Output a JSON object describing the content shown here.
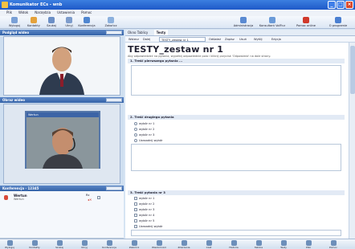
{
  "window": {
    "title": "Komunikator ECs - wnb"
  },
  "menu": [
    "Plik",
    "Widok",
    "Narzędzia",
    "Ustawienia",
    "Pomoc"
  ],
  "toolbar": {
    "left": [
      {
        "label": "Wyloguj",
        "icon": "logout-icon",
        "color": "#7aa0d6"
      },
      {
        "label": "Kontakty",
        "icon": "contacts-icon",
        "color": "#e4a23c"
      },
      {
        "label": "Szukaj",
        "icon": "search-icon",
        "color": "#6b8fc6"
      },
      {
        "label": "Ukryj",
        "icon": "hide-icon",
        "color": "#7d9ccc"
      },
      {
        "label": "Konferencja",
        "icon": "conference-icon",
        "color": "#4f86d0"
      },
      {
        "label": "Zakończ",
        "icon": "end-icon",
        "color": "#8cb0dd"
      }
    ],
    "right": [
      {
        "label": "Administracja",
        "icon": "admin-icon",
        "color": "#5a8ad2"
      },
      {
        "label": "Konsultant VoIP.cz",
        "icon": "consultant-icon",
        "color": "#6b9bd8"
      },
      {
        "label": "Pomoc online",
        "icon": "help-icon",
        "color": "#d0392b"
      },
      {
        "label": "O programie",
        "icon": "about-icon",
        "color": "#4a7fd1"
      }
    ]
  },
  "left": {
    "own_video_header": "Podgląd wideo",
    "remote_video_header": "Obraz wideo",
    "remote_name": "Wertun",
    "conference_header": "Konferencja - 12345",
    "participants": [
      {
        "name": "Wertun",
        "sub": "Wertun",
        "meta": "Rx"
      },
      {
        "name": "wnb",
        "sub": "Konsultant",
        "meta": ""
      }
    ]
  },
  "content": {
    "tabs": [
      "Okno Tablicy",
      "Testy"
    ],
    "address": {
      "back": "Wstecz",
      "next": "Dalej",
      "test": "TESTY_zestaw nr 1",
      "refresh": "Odśwież",
      "save": "Zapisz",
      "delete": "Usuń",
      "send": "Wyślij",
      "edit": "Edycja"
    },
    "test_title": "TESTY_zestaw nr 1",
    "test_subtitle": "Aby odpowiedzieć na pytania, wypełnij odpowiednie pola i kliknij przycisk 'Odpowiedz' na dole strony.",
    "questions": [
      {
        "label": "1. Treść pierwszego pytania ..."
      },
      {
        "label": "2. Treść drugiego pytania",
        "options": [
          "wybór nr 1",
          "wybór nr 2",
          "wybór nr 3",
          "Uzasadnij wybór"
        ]
      },
      {
        "label": "3. Treść pytania nr 3",
        "options": [
          "wybór nr 1",
          "wybór nr 2",
          "wybór nr 3",
          "wybór nr 4",
          "wybór nr 5",
          "Uzasadnij wybór"
        ]
      }
    ]
  },
  "status": {
    "items": [
      "Wyloguj",
      "Kontakty",
      "Szukaj",
      "Ukryj",
      "Konferencja",
      "Zakończ",
      "Wiadomości",
      "Zdarzenia",
      "Czat",
      "Historia",
      "Tablica",
      "Testy",
      "Pliki",
      "Pomoc"
    ]
  }
}
